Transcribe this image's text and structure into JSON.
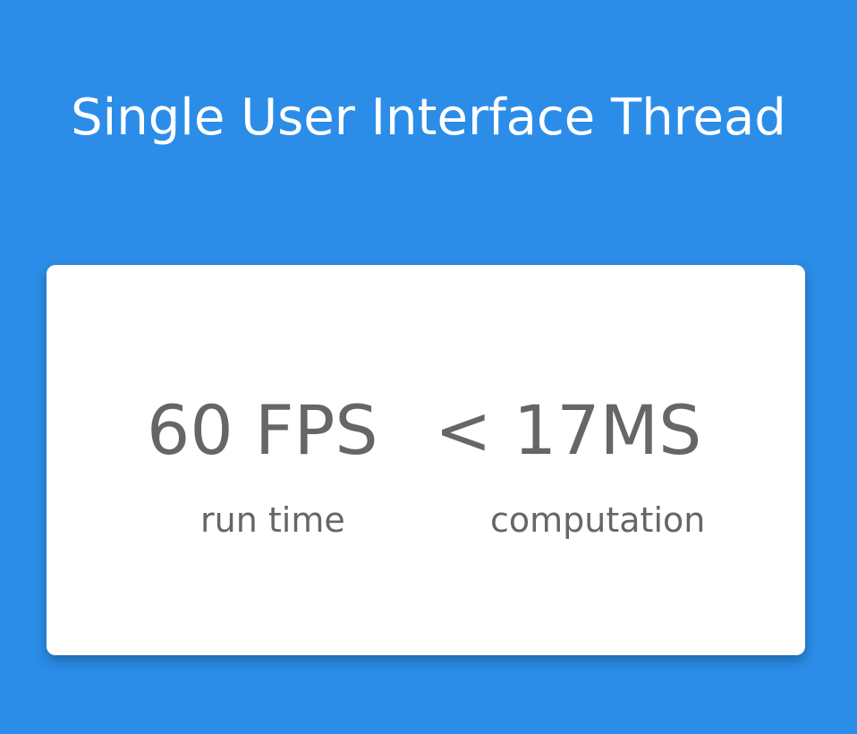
{
  "header": {
    "title": "Single User Interface Thread"
  },
  "card": {
    "fps_value": "60 FPS",
    "ms_value": "< 17MS",
    "fps_caption": "run time",
    "ms_caption": "computation"
  },
  "colors": {
    "background": "#2b8de8",
    "card": "#ffffff",
    "text": "#666666"
  }
}
